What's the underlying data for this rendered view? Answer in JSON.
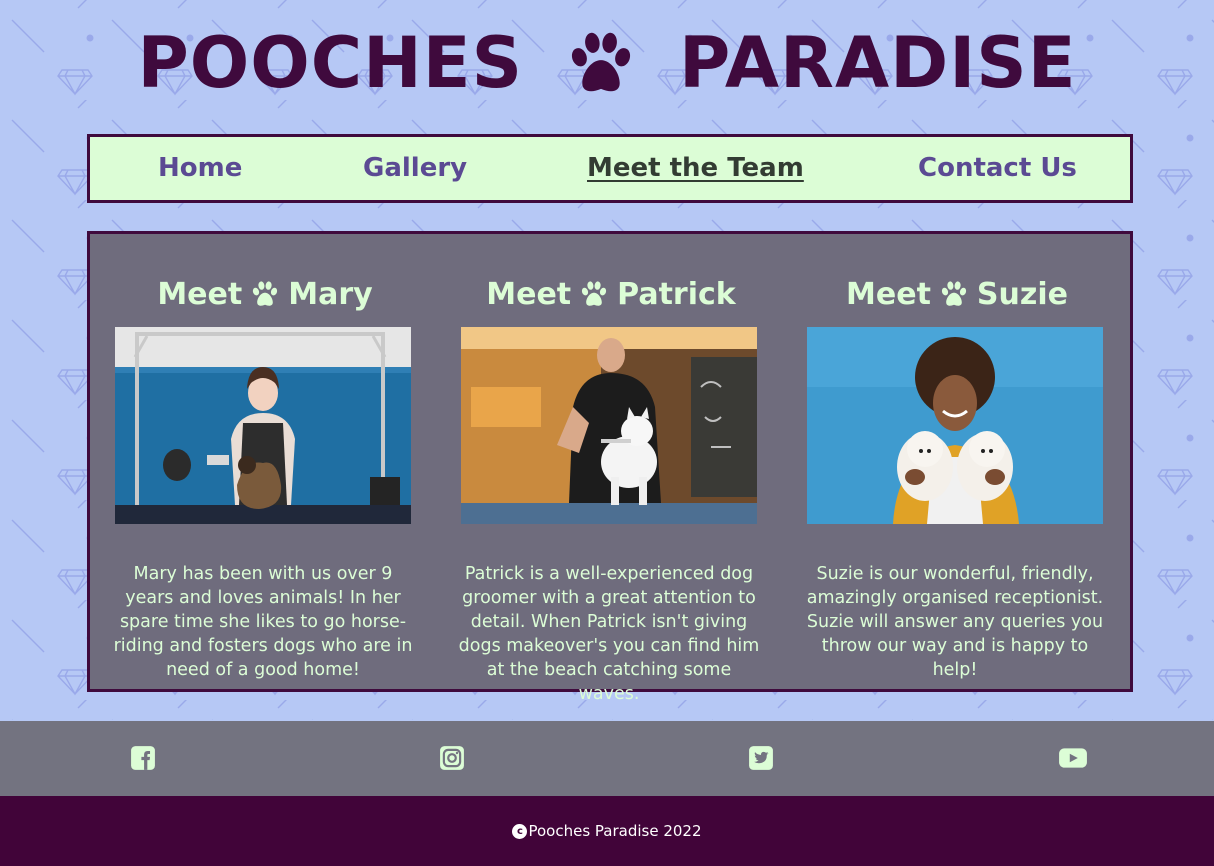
{
  "colors": {
    "background": "#b6c8f5",
    "brand_dark": "#3f0a3d",
    "nav_bg": "#dcfdd6",
    "nav_link": "#5b4a93",
    "nav_active": "#333c33",
    "panel_bg": "#6f6c7d",
    "panel_text": "#dcfdd6",
    "social_bg": "#737380",
    "footer_bg": "#410439"
  },
  "header": {
    "title_left": "POOCHES",
    "title_right": "PARADISE",
    "logo_icon": "paw-icon"
  },
  "nav": {
    "items": [
      {
        "label": "Home",
        "active": false
      },
      {
        "label": "Gallery",
        "active": false
      },
      {
        "label": "Meet the Team",
        "active": true
      },
      {
        "label": "Contact Us",
        "active": false
      }
    ]
  },
  "team": [
    {
      "prefix": "Meet",
      "name": "Mary",
      "photo": "woman grooming a Yorkshire terrier at a blue-walled grooming table",
      "bio": "Mary has been with us over 9 years and loves animals! In her spare time she likes to go horse-riding and fosters dogs who are in need of a good home!"
    },
    {
      "prefix": "Meet",
      "name": "Patrick",
      "photo": "man combing a white Pomeranian on a grooming table",
      "bio": "Patrick is a well-experienced dog groomer with a great attention to detail. When Patrick isn't giving dogs makeover's you can find him at the beach catching some waves."
    },
    {
      "prefix": "Meet",
      "name": "Suzie",
      "photo": "smiling woman holding two white fluffy puppies against a blue wall",
      "bio": "Suzie is our wonderful, friendly, amazingly organised receptionist. Suzie will answer any queries you throw our way and is happy to help!"
    }
  ],
  "social": {
    "icons": [
      "facebook-icon",
      "instagram-icon",
      "twitter-icon",
      "youtube-icon"
    ]
  },
  "footer": {
    "copyright_symbol": "c",
    "copyright_text": "Pooches Paradise 2022"
  }
}
